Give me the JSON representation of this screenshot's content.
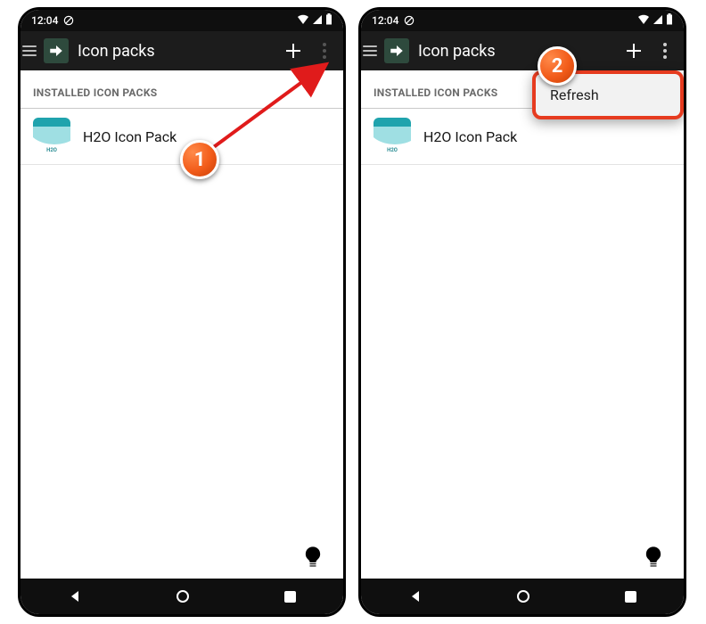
{
  "status": {
    "time": "12:04"
  },
  "appbar": {
    "title": "Icon packs"
  },
  "section": {
    "header": "INSTALLED ICON PACKS"
  },
  "packs": [
    {
      "name": "H2O Icon Pack",
      "icon_label": "H2O"
    }
  ],
  "popup": {
    "refresh": "Refresh"
  },
  "callouts": {
    "one": "1",
    "two": "2"
  }
}
